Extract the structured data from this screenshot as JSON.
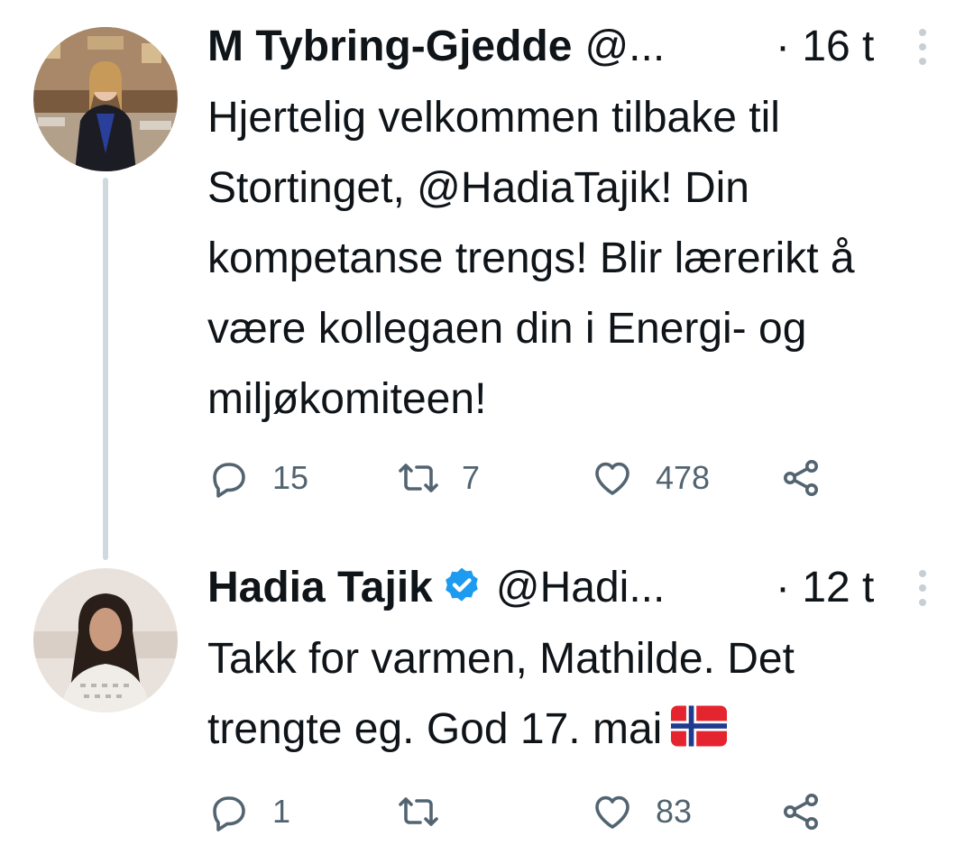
{
  "tweets": [
    {
      "name": "M Tybring-Gjedde",
      "handle": "@...",
      "time": "· 16 t",
      "verified": false,
      "text": "Hjertelig velkommen tilbake til Stortinget, @HadiaTajik! Din kompetanse trengs! Blir lærerikt å være kollegaen din i Energi- og miljøkomiteen!",
      "replies": "15",
      "retweets": "7",
      "likes": "478"
    },
    {
      "name": "Hadia Tajik",
      "handle": "@Hadi...",
      "time": "· 12 t",
      "verified": true,
      "text": "Takk for varmen, Mathilde. Det trengte eg. God 17. mai",
      "replies": "1",
      "retweets": "",
      "likes": "83"
    }
  ],
  "icons": {
    "reply": "speech-bubble-icon",
    "retweet": "retweet-icon",
    "like": "heart-icon",
    "share": "share-icon",
    "more": "vertical-dots-icon",
    "verified": "verified-badge-icon",
    "flag": "norway-flag-emoji"
  },
  "colors": {
    "text": "#0f1419",
    "secondary": "#536471",
    "verified": "#1d9bf0",
    "thread_line": "#cfd9de"
  }
}
